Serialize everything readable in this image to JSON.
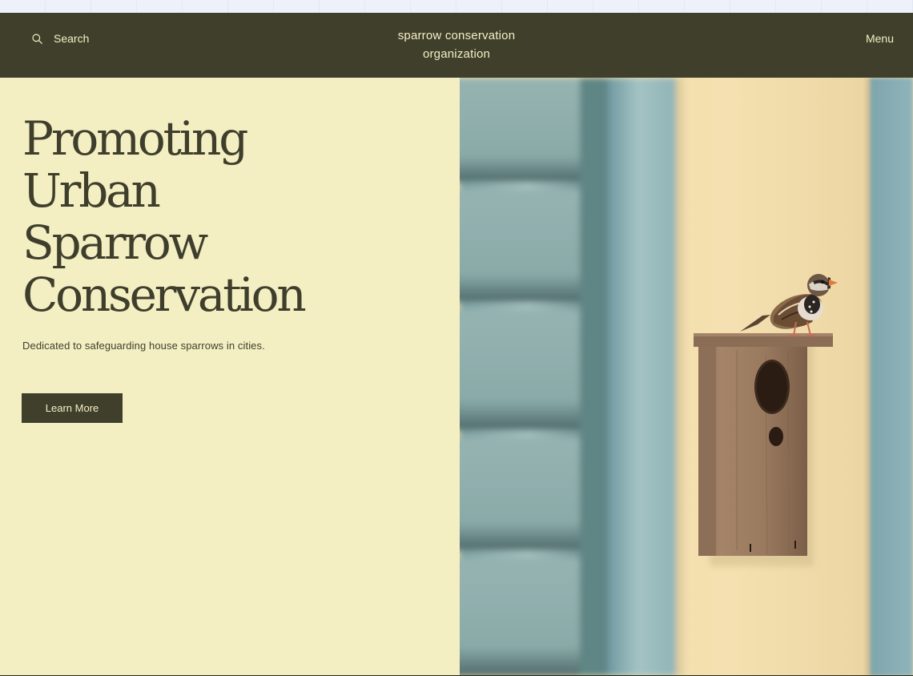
{
  "header": {
    "search_label": "Search",
    "brand_line1": "sparrow conservation",
    "brand_line2": "organization",
    "menu_label": "Menu"
  },
  "hero": {
    "headline": [
      "Promoting",
      "Urban",
      "Sparrow",
      "Conservation"
    ],
    "tagline": "Dedicated to safeguarding house sparrows in cities.",
    "cta_label": "Learn More"
  },
  "icons": {
    "search": "search-icon"
  },
  "colors": {
    "header_bg": "#403f2c",
    "page_bg": "#f3efc3",
    "text_dark": "#3f3e2c",
    "text_light": "#f3efc3"
  }
}
